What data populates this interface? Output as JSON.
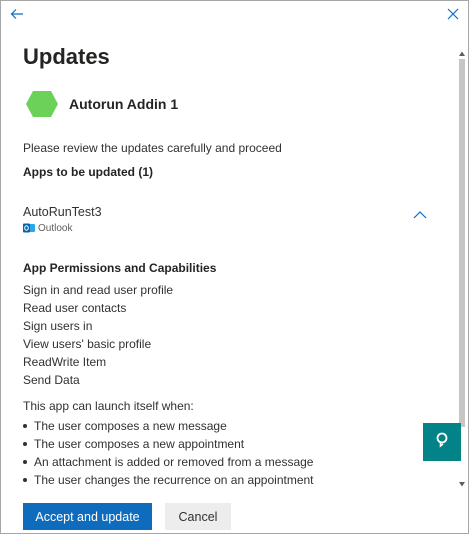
{
  "title": "Updates",
  "addin": {
    "name": "Autorun Addin 1",
    "icon": "hexagon-addin-icon",
    "color": "#6bd159"
  },
  "review_text": "Please review the updates carefully and proceed",
  "apps_heading": "Apps to be updated (1)",
  "app": {
    "name": "AutoRunTest3",
    "host": "Outlook",
    "host_icon": "outlook-icon"
  },
  "permissions": {
    "heading": "App Permissions and Capabilities",
    "items": [
      "Sign in and read user profile",
      "Read user contacts",
      "Sign users in",
      "View users' basic profile",
      "ReadWrite Item",
      "Send Data"
    ]
  },
  "launch": {
    "intro": "This app can launch itself when:",
    "items": [
      "The user composes a new message",
      "The user composes a new appointment",
      "An attachment is added or removed from a message",
      "The user changes the recurrence on an appointment"
    ]
  },
  "buttons": {
    "accept": "Accept and update",
    "cancel": "Cancel"
  },
  "colors": {
    "accent": "#0f6cbd",
    "feedback": "#038387",
    "back_arrow": "#0f6cbd"
  }
}
